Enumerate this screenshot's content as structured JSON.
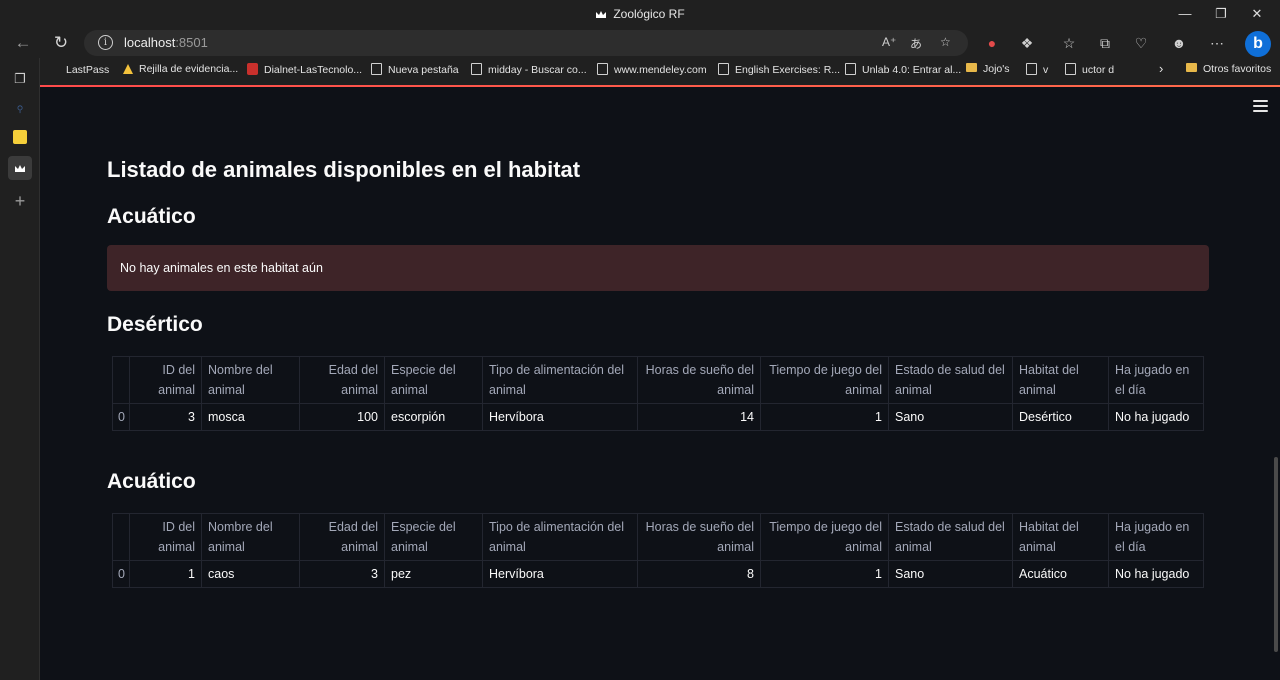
{
  "browser": {
    "title": "Zoológico RF",
    "url_host": "localhost",
    "url_port": ":8501",
    "bookmarks": [
      "LastPass",
      "Rejilla de evidencia...",
      "Dialnet-LasTecnolo...",
      "Nueva pestaña",
      "midday - Buscar co...",
      "www.mendeley.com",
      "English Exercises: R...",
      "Unlab 4.0: Entrar al...",
      "Jojo's",
      "v",
      "uctor d",
      "Otros favoritos"
    ]
  },
  "page": {
    "heading": "Listado de animales disponibles en el habitat",
    "sections": [
      {
        "title": "Acuático",
        "alert": "No hay animales en este habitat aún"
      },
      {
        "title": "Desértico"
      },
      {
        "title": "Acuático"
      }
    ],
    "columns": [
      "ID del animal",
      "Nombre del animal",
      "Edad del animal",
      "Especie del animal",
      "Tipo de alimentación del animal",
      "Horas de sueño del animal",
      "Tiempo de juego del animal",
      "Estado de salud del animal",
      "Habitat del animal",
      "Ha jugado en el día"
    ],
    "tables": [
      {
        "rows": [
          {
            "index": "0",
            "id": "3",
            "nombre": "mosca",
            "edad": "100",
            "especie": "escorpión",
            "alimentacion": "Hervíbora",
            "sueno": "14",
            "juego": "1",
            "salud": "Sano",
            "habitat": "Desértico",
            "jugado": "No ha jugado"
          }
        ]
      },
      {
        "rows": [
          {
            "index": "0",
            "id": "1",
            "nombre": "caos",
            "edad": "3",
            "especie": "pez",
            "alimentacion": "Hervíbora",
            "sueno": "8",
            "juego": "1",
            "salud": "Sano",
            "habitat": "Acuático",
            "jugado": "No ha jugado"
          }
        ]
      }
    ]
  }
}
